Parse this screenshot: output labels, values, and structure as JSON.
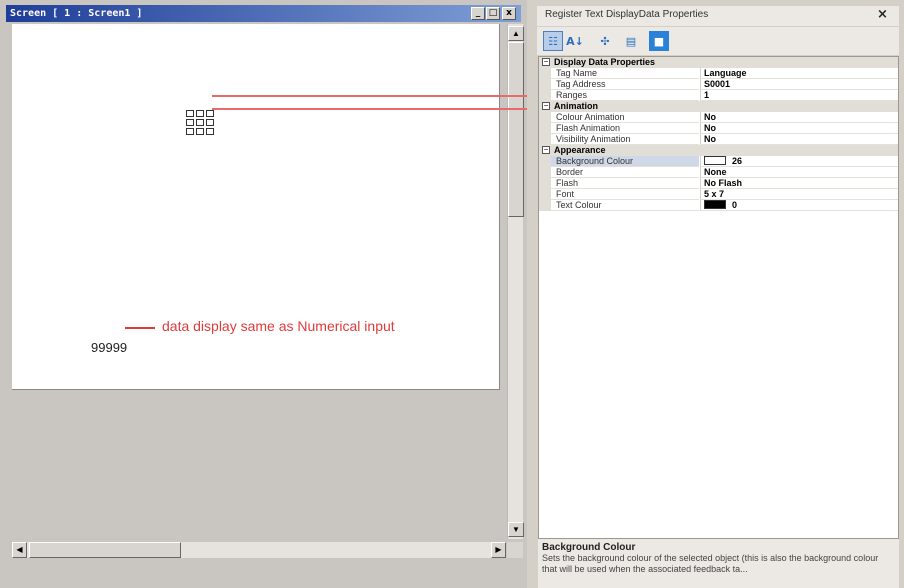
{
  "screen_window": {
    "title": "Screen [ 1 : Screen1 ]",
    "min_symbol": "_",
    "max_symbol": "□",
    "close_symbol": "x"
  },
  "canvas": {
    "data_display_value": "99999",
    "annotation": "data display same as Numerical input"
  },
  "properties": {
    "title": "Register Text DisplayData Properties",
    "close_symbol": "×",
    "categories": [
      {
        "label": "Display Data Properties",
        "rows": [
          {
            "name": "Tag Name",
            "value": "Language"
          },
          {
            "name": "Tag Address",
            "value": "S0001"
          },
          {
            "name": "Ranges",
            "value": "1"
          }
        ]
      },
      {
        "label": "Animation",
        "rows": [
          {
            "name": "Colour Animation",
            "value": "No"
          },
          {
            "name": "Flash Animation",
            "value": "No"
          },
          {
            "name": "Visibility Animation",
            "value": "No"
          }
        ]
      },
      {
        "label": "Appearance",
        "rows": [
          {
            "name": "Background Colour",
            "value": "26",
            "swatch": "#ffffff"
          },
          {
            "name": "Border",
            "value": "None"
          },
          {
            "name": "Flash",
            "value": "No Flash"
          },
          {
            "name": "Font",
            "value": "5 x 7"
          },
          {
            "name": "Text Colour",
            "value": "0",
            "swatch": "#000000"
          }
        ]
      }
    ],
    "description": {
      "title": "Background Colour",
      "text": "Sets the background colour of the selected object (this is also the background colour that will be used when the associated feedback ta..."
    }
  },
  "colors": {
    "annotation_red": "#e03b3b",
    "titlebar_blue": "#1e3d98",
    "selection": "#cfd8e6"
  }
}
